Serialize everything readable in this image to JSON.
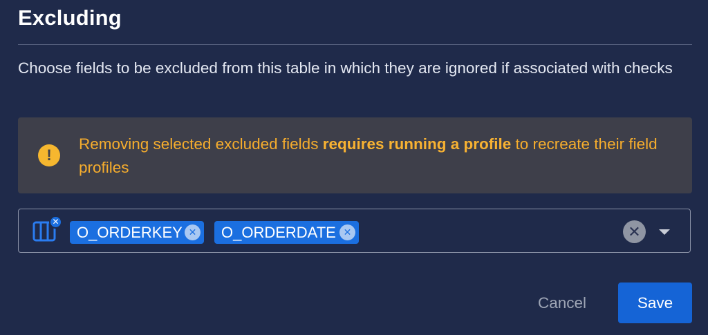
{
  "dialog": {
    "title": "Excluding",
    "description": "Choose fields to be excluded from this table in which they are ignored if associated with checks"
  },
  "warning": {
    "icon": "warning-circle-icon",
    "icon_glyph": "!",
    "text_before": "Removing selected excluded fields ",
    "text_bold": "requires running a profile",
    "text_after": " to recreate their field profiles",
    "color": "#f6ad2d"
  },
  "field_select": {
    "icon": "columns-icon",
    "badge_glyph": "✕",
    "chips": [
      {
        "label": "O_ORDERKEY",
        "remove_glyph": "✕"
      },
      {
        "label": "O_ORDERDATE",
        "remove_glyph": "✕"
      }
    ],
    "clear_glyph": "✕",
    "chip_color": "#1b6fe0"
  },
  "actions": {
    "cancel_label": "Cancel",
    "save_label": "Save",
    "primary_color": "#1564d6"
  }
}
